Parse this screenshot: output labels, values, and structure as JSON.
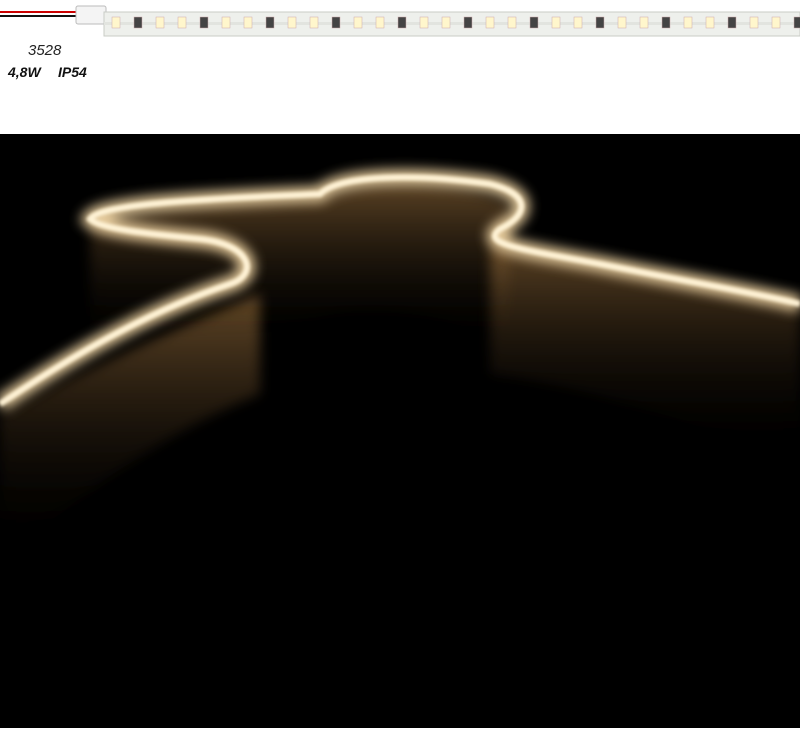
{
  "product": {
    "model": "3528",
    "power": "4,8W",
    "ip_rating": "IP54"
  },
  "colors": {
    "led_glow": "#ffd79a",
    "strip_body": "#eef0ec",
    "background_dark": "#000000"
  }
}
